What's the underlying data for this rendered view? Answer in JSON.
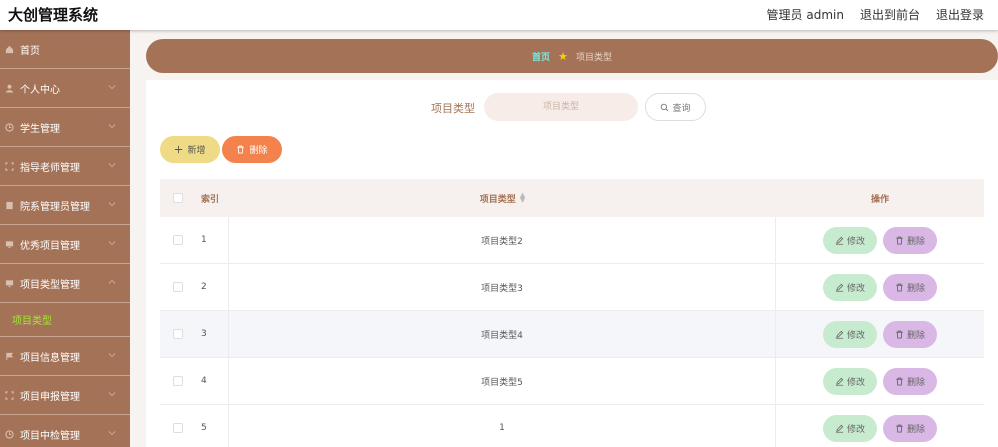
{
  "app": {
    "title": "大创管理系统"
  },
  "topnav": {
    "admin_label": "管理员 admin",
    "front_label": "退出到前台",
    "logout_label": "退出登录"
  },
  "sidebar": {
    "items": [
      {
        "label": "首页",
        "icon": "home-icon"
      },
      {
        "label": "个人中心",
        "icon": "user-icon"
      },
      {
        "label": "学生管理",
        "icon": "clock-icon"
      },
      {
        "label": "指导老师管理",
        "icon": "scan-icon"
      },
      {
        "label": "院系管理员管理",
        "icon": "doc-icon"
      },
      {
        "label": "优秀项目管理",
        "icon": "monitor-icon"
      },
      {
        "label": "项目类型管理",
        "icon": "monitor-icon"
      },
      {
        "label": "项目信息管理",
        "icon": "flag-icon"
      },
      {
        "label": "项目申报管理",
        "icon": "scan-icon"
      },
      {
        "label": "项目中检管理",
        "icon": "clock-icon"
      }
    ],
    "active_sub": "项目类型"
  },
  "breadcrumb": {
    "home": "首页",
    "current": "项目类型"
  },
  "search": {
    "label": "项目类型",
    "placeholder": "项目类型",
    "button": "查询"
  },
  "actions": {
    "add": "新增",
    "delete": "删除"
  },
  "table": {
    "headers": {
      "index": "索引",
      "type": "项目类型",
      "ops": "操作"
    },
    "edit_label": "修改",
    "delete_label": "删除",
    "rows": [
      {
        "index": "1",
        "type": "项目类型2"
      },
      {
        "index": "2",
        "type": "项目类型3"
      },
      {
        "index": "3",
        "type": "项目类型4"
      },
      {
        "index": "4",
        "type": "项目类型5"
      },
      {
        "index": "5",
        "type": "1"
      }
    ]
  },
  "colors": {
    "brand": "#a47357",
    "edit": "#c7ebcf",
    "remove": "#d9b8e6",
    "add": "#efdb85",
    "danger": "#f4824c"
  }
}
